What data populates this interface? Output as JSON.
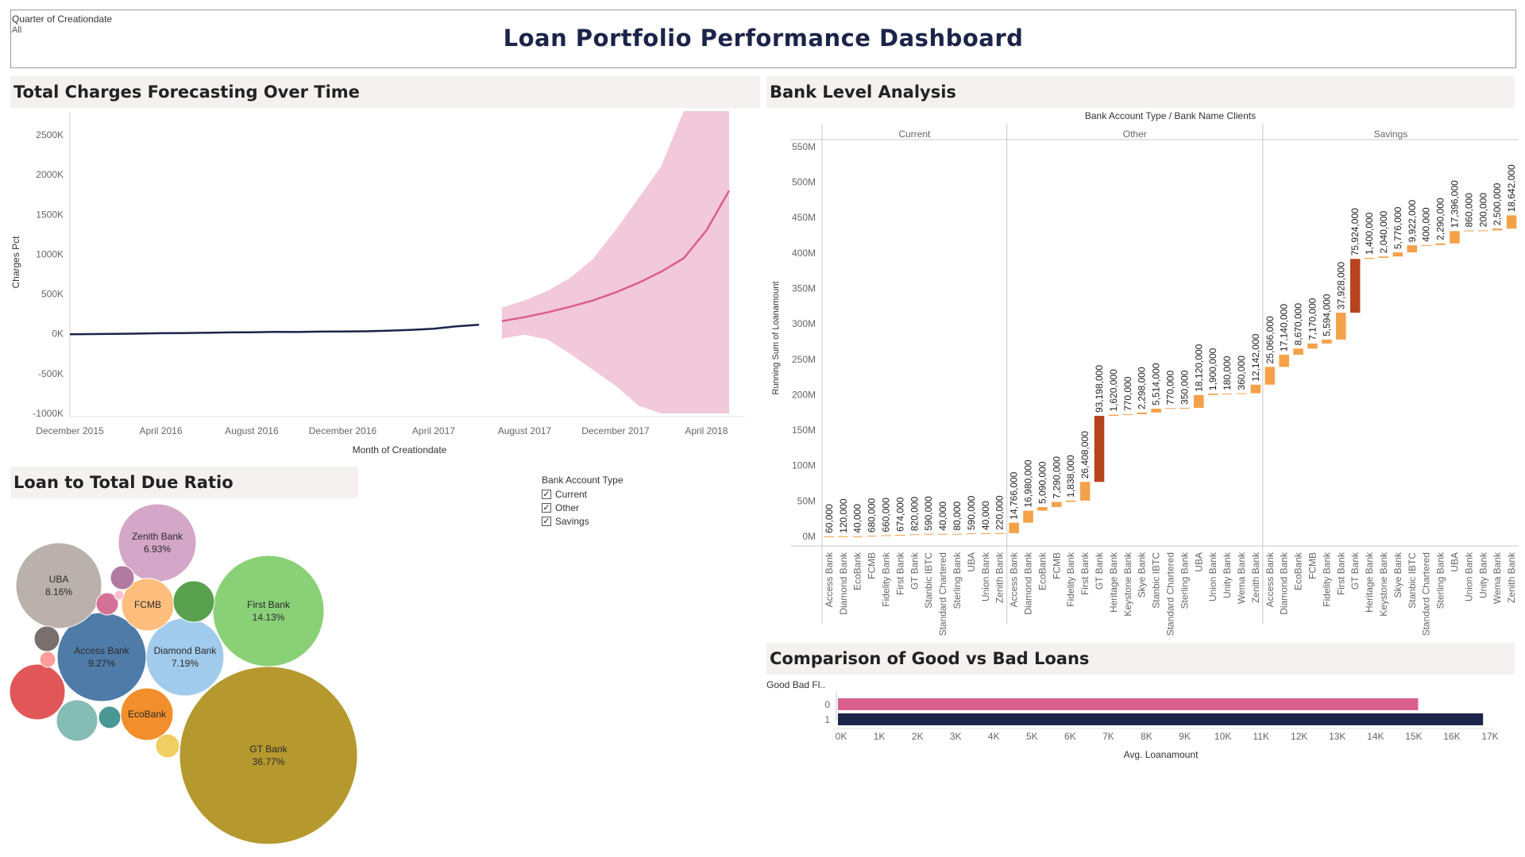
{
  "filter": {
    "label": "Quarter of Creationdate",
    "value": "All"
  },
  "dashboard_title": "Loan Portfolio Performance Dashboard",
  "sections": {
    "forecast": "Total Charges Forecasting Over Time",
    "bank": "Bank Level Analysis",
    "ratio": "Loan to Total Due Ratio",
    "goodbad": "Comparison of Good vs Bad Loans"
  },
  "legend": {
    "title": "Bank Account Type",
    "items": [
      "Current",
      "Other",
      "Savings"
    ],
    "check": "✓"
  },
  "colors": {
    "actual": "#1c2449",
    "forecast": "#d9608d",
    "band": "#f2c9da",
    "waterfall": "#f4a14a",
    "waterfall_big": "#b8431f",
    "bar0": "#d9608d",
    "bar1": "#1c2449"
  },
  "chart_data": [
    {
      "type": "line",
      "title": "Total Charges Forecasting Over Time",
      "xlabel": "Month of Creationdate",
      "ylabel": "Charges Pct",
      "ylim": [
        -1000,
        2800
      ],
      "yticks": [
        -1000,
        -500,
        0,
        500,
        1000,
        1500,
        2000,
        2500
      ],
      "ytick_labels": [
        "-1000K",
        "-500K",
        "0K",
        "500K",
        "1000K",
        "1500K",
        "2000K",
        "2500K"
      ],
      "xlim": [
        0,
        29
      ],
      "xticks": [
        {
          "x": 0,
          "label": "December 2015"
        },
        {
          "x": 4,
          "label": "April 2016"
        },
        {
          "x": 8,
          "label": "August 2016"
        },
        {
          "x": 12,
          "label": "December 2016"
        },
        {
          "x": 16,
          "label": "April 2017"
        },
        {
          "x": 20,
          "label": "August 2017"
        },
        {
          "x": 24,
          "label": "December 2017"
        },
        {
          "x": 28,
          "label": "April 2018"
        }
      ],
      "series": [
        {
          "kind": "actual",
          "x": [
            0,
            1,
            2,
            3,
            4,
            5,
            6,
            7,
            8,
            9,
            10,
            11,
            12,
            13,
            14,
            15,
            16,
            17,
            18
          ],
          "y": [
            -5,
            -3,
            0,
            4,
            8,
            10,
            14,
            18,
            20,
            25,
            24,
            28,
            30,
            32,
            40,
            50,
            65,
            95,
            115
          ]
        },
        {
          "kind": "forecast",
          "x": [
            19,
            20,
            21,
            22,
            23,
            24,
            25,
            26,
            27,
            28,
            29
          ],
          "y": [
            160,
            210,
            270,
            340,
            420,
            520,
            640,
            780,
            950,
            1300,
            1800
          ],
          "lower": [
            -60,
            -10,
            -70,
            -250,
            -450,
            -650,
            -900,
            -1000,
            -1000,
            -1000,
            -1000
          ],
          "upper": [
            330,
            420,
            540,
            700,
            940,
            1300,
            1700,
            2100,
            2800,
            2800,
            2800
          ]
        }
      ]
    },
    {
      "type": "bar",
      "subtype": "waterfall",
      "header": "Bank Account Type / Bank Name Clients",
      "ylabel": "Running Sum of Loanamount",
      "ylim": [
        0,
        560
      ],
      "yticks": [
        0,
        50,
        100,
        150,
        200,
        250,
        300,
        350,
        400,
        450,
        500,
        550
      ],
      "ytick_labels": [
        "0M",
        "50M",
        "100M",
        "150M",
        "200M",
        "250M",
        "300M",
        "350M",
        "400M",
        "450M",
        "500M",
        "550M"
      ],
      "groups": [
        {
          "name": "Current",
          "categories": [
            "Access Bank",
            "Diamond Bank",
            "EcoBank",
            "FCMB",
            "Fidelity Bank",
            "First Bank",
            "GT Bank",
            "Stanbic IBTC",
            "Standard Chartered",
            "Sterling Bank",
            "UBA",
            "Union Bank",
            "Zenith Bank"
          ],
          "values": [
            60000,
            120000,
            40000,
            680000,
            660000,
            674000,
            820000,
            590000,
            40000,
            80000,
            590000,
            40000,
            220000
          ],
          "labels": [
            "60,000",
            "120,000",
            "40,000",
            "680,000",
            "660,000",
            "674,000",
            "820,000",
            "590,000",
            "40,000",
            "80,000",
            "590,000",
            "40,000",
            "220,000"
          ]
        },
        {
          "name": "Other",
          "categories": [
            "Access Bank",
            "Diamond Bank",
            "EcoBank",
            "FCMB",
            "Fidelity Bank",
            "First Bank",
            "GT Bank",
            "Heritage Bank",
            "Keystone Bank",
            "Skye Bank",
            "Stanbic IBTC",
            "Standard Chartered",
            "Sterling Bank",
            "UBA",
            "Union Bank",
            "Unity Bank",
            "Wema Bank",
            "Zenith Bank"
          ],
          "values": [
            14766000,
            16980000,
            5090000,
            7290000,
            1838000,
            26408000,
            93198000,
            1620000,
            770000,
            2298000,
            5514000,
            770000,
            350000,
            18120000,
            1900000,
            180000,
            360000,
            12142000
          ],
          "labels": [
            "14,766,000",
            "16,980,000",
            "5,090,000",
            "7,290,000",
            "1,838,000",
            "26,408,000",
            "93,198,000",
            "1,620,000",
            "770,000",
            "2,298,000",
            "5,514,000",
            "770,000",
            "350,000",
            "18,120,000",
            "1,900,000",
            "180,000",
            "360,000",
            "12,142,000"
          ]
        },
        {
          "name": "Savings",
          "categories": [
            "Access Bank",
            "Diamond Bank",
            "EcoBank",
            "FCMB",
            "Fidelity Bank",
            "First Bank",
            "GT Bank",
            "Heritage Bank",
            "Keystone Bank",
            "Skye Bank",
            "Stanbic IBTC",
            "Standard Chartered",
            "Sterling Bank",
            "UBA",
            "Union Bank",
            "Unity Bank",
            "Wema Bank",
            "Zenith Bank"
          ],
          "values": [
            25066000,
            17140000,
            8670000,
            7170000,
            5594000,
            37928000,
            75924000,
            1400000,
            2040000,
            5776000,
            9922000,
            400000,
            2290000,
            17396000,
            860000,
            200000,
            2500000,
            18642000
          ],
          "labels": [
            "25,066,000",
            "17,140,000",
            "8,670,000",
            "7,170,000",
            "5,594,000",
            "37,928,000",
            "75,924,000",
            "1,400,000",
            "2,040,000",
            "5,776,000",
            "9,922,000",
            "400,000",
            "2,290,000",
            "17,396,000",
            "860,000",
            "200,000",
            "2,500,000",
            "18,642,000"
          ]
        }
      ]
    },
    {
      "type": "scatter",
      "subtype": "packed-bubble",
      "title": "Loan to Total Due Ratio",
      "bubbles": [
        {
          "name": "GT Bank",
          "label": "GT Bank",
          "pct": "36.77%",
          "color": "#b5992e"
        },
        {
          "name": "First Bank",
          "label": "First Bank",
          "pct": "14.13%",
          "color": "#8ad077"
        },
        {
          "name": "Access Bank",
          "label": "Access Bank",
          "pct": "9.27%",
          "color": "#4f7ba8"
        },
        {
          "name": "UBA",
          "label": "UBA",
          "pct": "8.16%",
          "color": "#bab0ac"
        },
        {
          "name": "Diamond Bank",
          "label": "Diamond Bank",
          "pct": "7.19%",
          "color": "#a1cbec"
        },
        {
          "name": "Zenith Bank",
          "label": "Zenith Bank",
          "pct": "6.93%",
          "color": "#d4a6c8"
        },
        {
          "name": "FCMB",
          "label": "FCMB",
          "pct": "",
          "color": "#ffbe7d"
        },
        {
          "name": "EcoBank",
          "label": "EcoBank",
          "pct": "",
          "color": "#f28e2b"
        },
        {
          "name": "",
          "label": "",
          "pct": "",
          "color": "#e15759"
        },
        {
          "name": "",
          "label": "",
          "pct": "",
          "color": "#86bcb6"
        },
        {
          "name": "",
          "label": "",
          "pct": "",
          "color": "#59a14f"
        },
        {
          "name": "",
          "label": "",
          "pct": "",
          "color": "#b07aa1"
        },
        {
          "name": "",
          "label": "",
          "pct": "",
          "color": "#79706e"
        },
        {
          "name": "",
          "label": "",
          "pct": "",
          "color": "#d37295"
        },
        {
          "name": "",
          "label": "",
          "pct": "",
          "color": "#499894"
        },
        {
          "name": "",
          "label": "",
          "pct": "",
          "color": "#f1ce63"
        },
        {
          "name": "",
          "label": "",
          "pct": "",
          "color": "#ff9d9a"
        },
        {
          "name": "",
          "label": "",
          "pct": "",
          "color": "#fabfd2"
        }
      ]
    },
    {
      "type": "bar",
      "orientation": "horizontal",
      "title": "Comparison of Good vs Bad Loans",
      "ylabel": "Good Bad Fl..",
      "xlabel": "Avg. Loanamount",
      "categories": [
        "0",
        "1"
      ],
      "values": [
        15200,
        16900
      ],
      "xlim": [
        0,
        17000
      ],
      "xticks": [
        0,
        1000,
        2000,
        3000,
        4000,
        5000,
        6000,
        7000,
        8000,
        9000,
        10000,
        11000,
        12000,
        13000,
        14000,
        15000,
        16000,
        17000
      ],
      "xtick_labels": [
        "0K",
        "1K",
        "2K",
        "3K",
        "4K",
        "5K",
        "6K",
        "7K",
        "8K",
        "9K",
        "10K",
        "11K",
        "12K",
        "13K",
        "14K",
        "15K",
        "16K",
        "17K"
      ]
    }
  ]
}
